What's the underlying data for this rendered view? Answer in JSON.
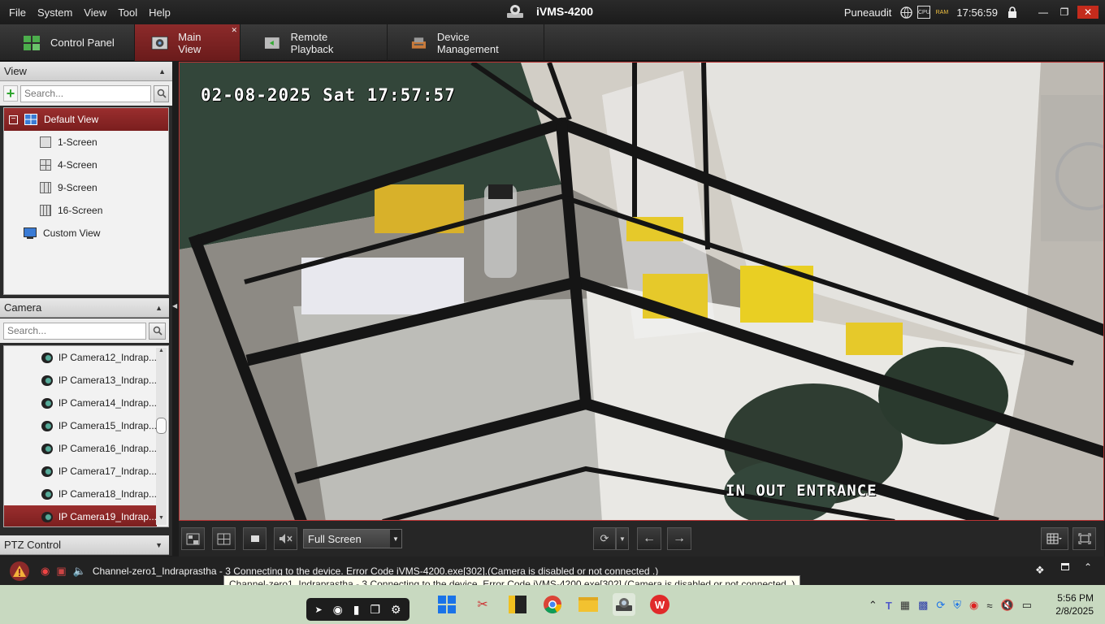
{
  "menu": [
    "File",
    "System",
    "View",
    "Tool",
    "Help"
  ],
  "app_title": "iVMS-4200",
  "user": "Puneaudit",
  "clock": "17:56:59",
  "tray_badge_cpu": "CPU",
  "tray_badge_ram": "RAM",
  "tabs": {
    "control_panel": "Control Panel",
    "main_view": "Main View",
    "remote_playback": "Remote Playback",
    "device_management": "Device Management"
  },
  "view_panel": {
    "title": "View",
    "search_placeholder": "Search...",
    "default_view": "Default View",
    "screens": [
      "1-Screen",
      "4-Screen",
      "9-Screen",
      "16-Screen"
    ],
    "custom_view": "Custom View"
  },
  "camera_panel": {
    "title": "Camera",
    "search_placeholder": "Search...",
    "cameras": [
      "IP Camera12_Indrap...",
      "IP Camera13_Indrap...",
      "IP Camera14_Indrap...",
      "IP Camera15_Indrap...",
      "IP Camera16_Indrap...",
      "IP Camera17_Indrap...",
      "IP Camera18_Indrap...",
      "IP Camera19_Indrap..."
    ],
    "selected_index": 7
  },
  "ptz_panel": {
    "title": "PTZ Control"
  },
  "video": {
    "timestamp": "02-08-2025 Sat 17:57:57",
    "label": "IN OUT ENTRANCE"
  },
  "toolbar": {
    "window_mode": "Full Screen"
  },
  "status": {
    "message": "Channel-zero1_Indraprastha - 3 Connecting to the device. Error Code iVMS-4200.exe[302].(Camera is disabled or not connected .)",
    "tooltip": "Channel-zero1_Indraprastha - 3 Connecting to the device. Error Code iVMS-4200.exe[302].(Camera is disabled or not connected .)"
  },
  "taskbar": {
    "time": "5:56 PM",
    "date": "2/8/2025"
  },
  "colors": {
    "accent": "#8c2a2a",
    "titlebar": "#1f1f1f",
    "taskbar": "#c8d9c0"
  }
}
